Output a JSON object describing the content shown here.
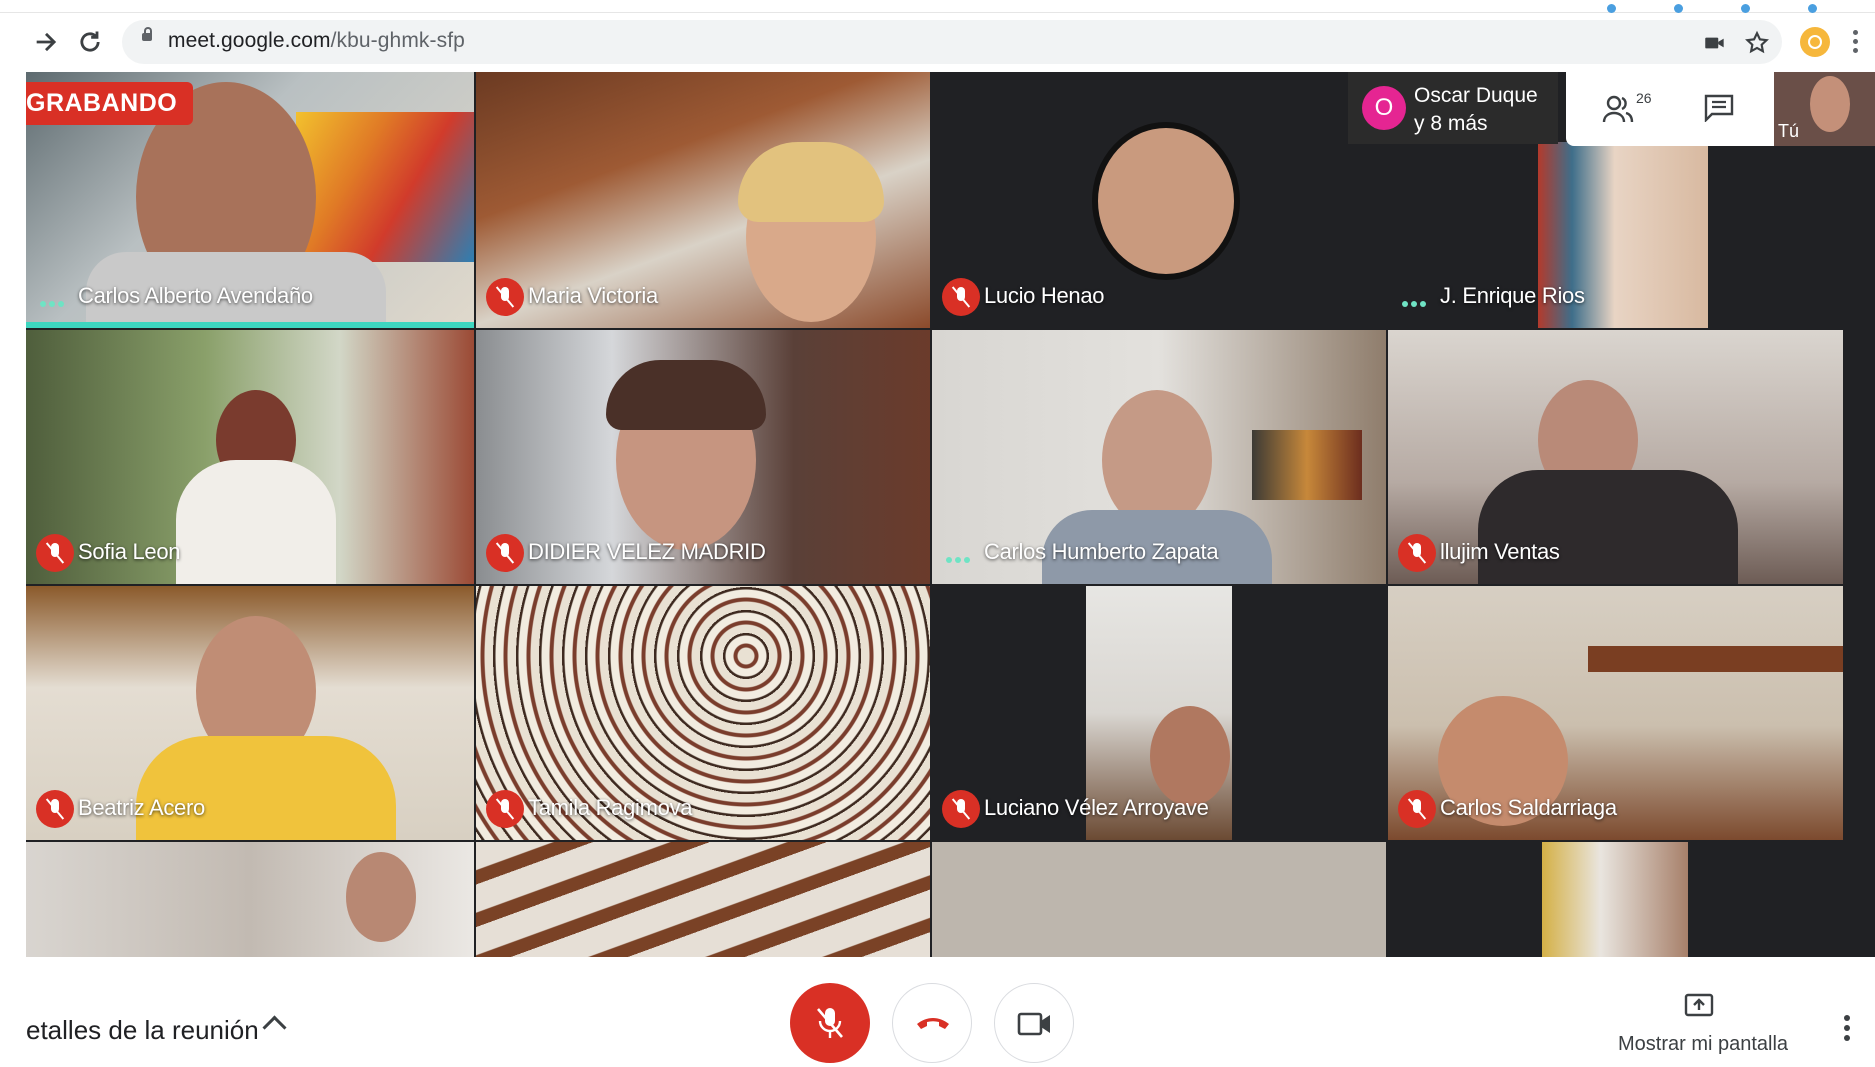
{
  "browser": {
    "url_host": "meet.google.com",
    "url_path": "/kbu-ghmk-sfp"
  },
  "meeting": {
    "recording_badge": "GRABANDO",
    "others_initial": "O",
    "others_line1": "Oscar Duque",
    "others_line2": "y 8 más",
    "participants_count": "26",
    "self_label": "Tú"
  },
  "tiles": [
    {
      "name": "Carlos Alberto Avendaño",
      "state": "speaking"
    },
    {
      "name": "Maria Victoria",
      "state": "muted"
    },
    {
      "name": "Lucio Henao",
      "state": "muted"
    },
    {
      "name": "J. Enrique Rios",
      "state": "speaking"
    },
    {
      "name": "Sofia Leon",
      "state": "muted"
    },
    {
      "name": "DIDIER VELEZ MADRID",
      "state": "muted"
    },
    {
      "name": "Carlos Humberto Zapata",
      "state": "speaking"
    },
    {
      "name": "llujim Ventas",
      "state": "muted"
    },
    {
      "name": "Beatriz Acero",
      "state": "muted"
    },
    {
      "name": "Tamila Ragimova",
      "state": "muted"
    },
    {
      "name": "Luciano Vélez Arroyave",
      "state": "muted"
    },
    {
      "name": "Carlos Saldarriaga",
      "state": "muted"
    }
  ],
  "bottom_bar": {
    "details_label": "etalles de la reunión",
    "share_label": "Mostrar mi pantalla"
  },
  "colors": {
    "mute_red": "#d93025",
    "speaking_teal": "#3dd6c0",
    "others_avatar": "#e52592"
  }
}
